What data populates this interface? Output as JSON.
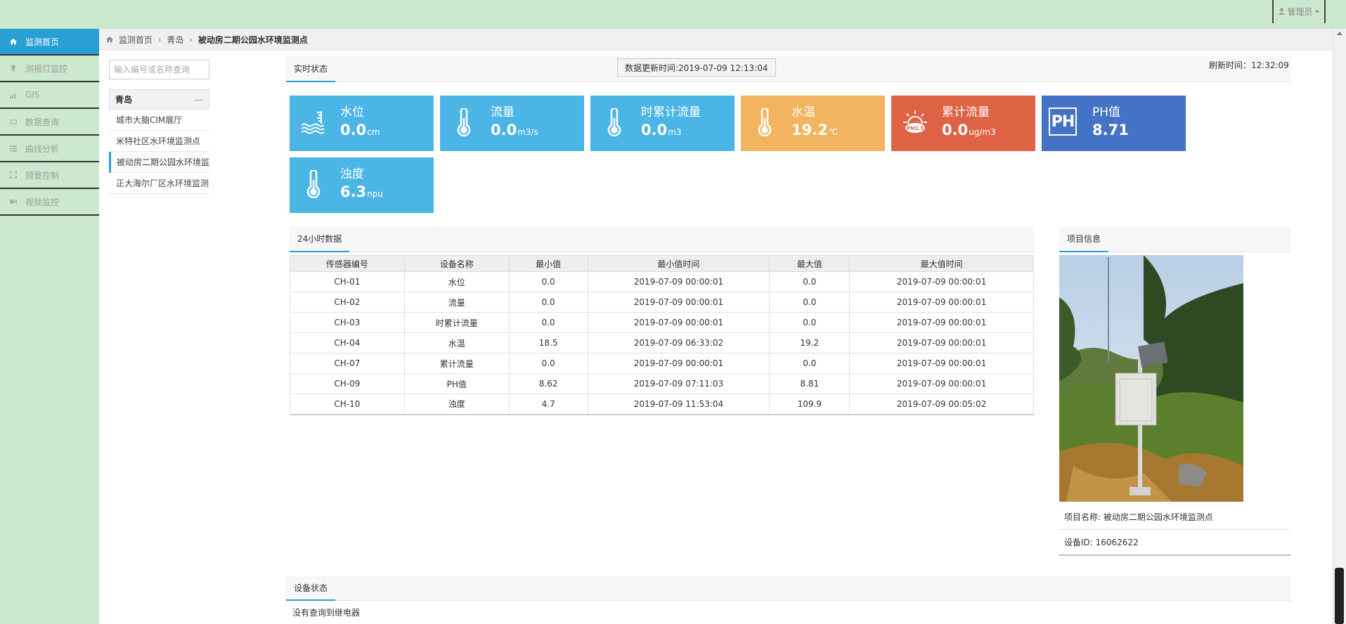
{
  "header": {
    "admin_label": "管理员"
  },
  "sidebar": {
    "items": [
      {
        "label": "监测首页",
        "icon": "home-icon"
      },
      {
        "label": "测报灯监控",
        "icon": "bulb-icon"
      },
      {
        "label": "GIS",
        "icon": "signal-icon"
      },
      {
        "label": "数据查询",
        "icon": "drive-icon"
      },
      {
        "label": "曲线分析",
        "icon": "grid-icon"
      },
      {
        "label": "预警控制",
        "icon": "expand-icon"
      },
      {
        "label": "视频监控",
        "icon": "video-icon"
      }
    ]
  },
  "breadcrumb": {
    "home": "监测首页",
    "city": "青岛",
    "current": "被动房二期公园水环境监测点"
  },
  "tree": {
    "search_placeholder": "输入编号或名称查询",
    "group": "青岛",
    "items": [
      "城市大脑CIM展厅",
      "米特社区水环境监测点",
      "被动房二期公园水环境监测点",
      "正大海尔厂区水环境监测点"
    ]
  },
  "realtime": {
    "tab_label": "实时状态",
    "update_time": "数据更新时间:2019-07-09 12:13:04",
    "refresh_time": "刷新时间：12:32:09",
    "cards": [
      {
        "title": "水位",
        "value": "0.0",
        "unit": "cm",
        "icon": "water-level-icon",
        "color": "#4bb5e5"
      },
      {
        "title": "流量",
        "value": "0.0",
        "unit": "m3/s",
        "icon": "thermometer-icon",
        "color": "#4bb5e5"
      },
      {
        "title": "时累计流量",
        "value": "0.0",
        "unit": "m3",
        "icon": "thermometer-icon",
        "color": "#4bb5e5"
      },
      {
        "title": "水温",
        "value": "19.2",
        "unit": "℃",
        "icon": "thermometer-icon",
        "color": "#f2b45e"
      },
      {
        "title": "累计流量",
        "value": "0.0",
        "unit": "ug/m3",
        "icon": "pm25-sun-icon",
        "color": "#de6345",
        "icon_text": "PM2.5"
      },
      {
        "title": "PH值",
        "value": "8.71",
        "unit": "",
        "icon": "ph-icon",
        "color": "#4472c4",
        "icon_text": "PH"
      },
      {
        "title": "浊度",
        "value": "6.3",
        "unit": "npu",
        "icon": "thermometer-icon",
        "color": "#4bb5e5"
      }
    ]
  },
  "data24h": {
    "tab_label": "24小时数据",
    "columns": [
      "传感器编号",
      "设备名称",
      "最小值",
      "最小值时间",
      "最大值",
      "最大值时间"
    ],
    "rows": [
      [
        "CH-01",
        "水位",
        "0.0",
        "2019-07-09 00:00:01",
        "0.0",
        "2019-07-09 00:00:01"
      ],
      [
        "CH-02",
        "流量",
        "0.0",
        "2019-07-09 00:00:01",
        "0.0",
        "2019-07-09 00:00:01"
      ],
      [
        "CH-03",
        "时累计流量",
        "0.0",
        "2019-07-09 00:00:01",
        "0.0",
        "2019-07-09 00:00:01"
      ],
      [
        "CH-04",
        "水温",
        "18.5",
        "2019-07-09 06:33:02",
        "19.2",
        "2019-07-09 00:00:01"
      ],
      [
        "CH-07",
        "累计流量",
        "0.0",
        "2019-07-09 00:00:01",
        "0.0",
        "2019-07-09 00:00:01"
      ],
      [
        "CH-09",
        "PH值",
        "8.62",
        "2019-07-09 07:11:03",
        "8.81",
        "2019-07-09 00:00:01"
      ],
      [
        "CH-10",
        "浊度",
        "4.7",
        "2019-07-09 11:53:04",
        "109.9",
        "2019-07-09 00:05:02"
      ]
    ]
  },
  "project": {
    "tab_label": "项目信息",
    "name_line": "项目名称:   被动房二期公园水环境监测点",
    "device_line": "设备ID:   16062622"
  },
  "device_status": {
    "tab_label": "设备状态",
    "message": "没有查询到继电器"
  }
}
